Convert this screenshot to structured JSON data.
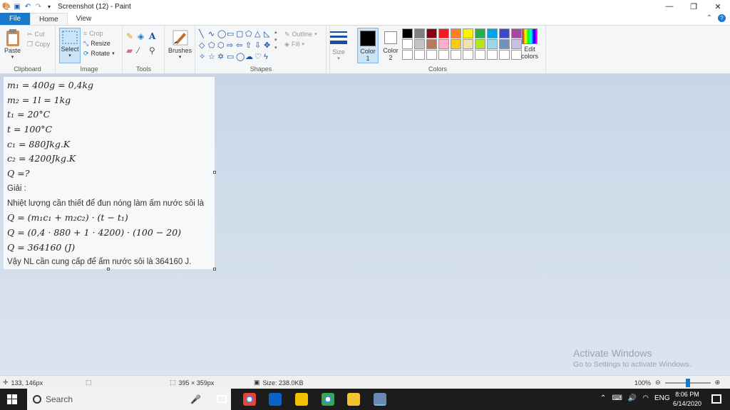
{
  "window": {
    "title": "Screenshot (12) - Paint",
    "minimize": "—",
    "maximize": "❐",
    "close": "✕"
  },
  "tabs": {
    "file": "File",
    "home": "Home",
    "view": "View"
  },
  "ribbon": {
    "clipboard": {
      "label": "Clipboard",
      "paste": "Paste",
      "cut": "Cut",
      "copy": "Copy"
    },
    "image": {
      "label": "Image",
      "select": "Select",
      "crop": "Crop",
      "resize": "Resize",
      "rotate": "Rotate"
    },
    "tools": {
      "label": "Tools"
    },
    "brushes": {
      "label": "Brushes"
    },
    "shapes": {
      "label": "Shapes",
      "outline": "Outline",
      "fill": "Fill"
    },
    "size": {
      "label": "Size"
    },
    "color1": {
      "label": "Color",
      "num": "1"
    },
    "color2": {
      "label": "Color",
      "num": "2"
    },
    "edit_colors": {
      "line1": "Edit",
      "line2": "colors"
    },
    "colors": {
      "label": "Colors"
    }
  },
  "palette": [
    "#000000",
    "#7f7f7f",
    "#880015",
    "#ed1c24",
    "#ff7f27",
    "#fff200",
    "#22b14c",
    "#00a2e8",
    "#3f48cc",
    "#a349a4",
    "#ffffff",
    "#c3c3c3",
    "#b97a57",
    "#ffaec9",
    "#ffc90e",
    "#efe4b0",
    "#b5e61d",
    "#99d9ea",
    "#7092be",
    "#c8bfe7",
    "#ffffff",
    "#ffffff",
    "#ffffff",
    "#ffffff",
    "#ffffff",
    "#ffffff",
    "#ffffff",
    "#ffffff",
    "#ffffff",
    "#ffffff"
  ],
  "image_lines": [
    {
      "text": "m₁ = 400g = 0,4kg",
      "kind": "math"
    },
    {
      "text": "m₂ = 1l = 1kg",
      "kind": "math"
    },
    {
      "text": "t₁ = 20°C",
      "kind": "math"
    },
    {
      "text": "t = 100°C",
      "kind": "math"
    },
    {
      "text": "c₁ = 880Jkg.K",
      "kind": "math"
    },
    {
      "text": "c₂ = 4200Jkg.K",
      "kind": "math"
    },
    {
      "text": "Q =?",
      "kind": "math"
    },
    {
      "text": "Giải :",
      "kind": "text"
    },
    {
      "text": "Nhiệt lượng cần thiết để đun nóng làm ấm nước sôi là",
      "kind": "text"
    },
    {
      "text": "Q = (m₁c₁ + m₂c₂) · (t − t₁)",
      "kind": "math"
    },
    {
      "text": "Q = (0,4 · 880 + 1 · 4200) · (100 − 20)",
      "kind": "math"
    },
    {
      "text": "Q = 364160 (J)",
      "kind": "math"
    },
    {
      "text": "Vậy NL cần cung cấp để ấm nước sôi là 364160 J.",
      "kind": "text"
    }
  ],
  "watermark": {
    "line1": "Activate Windows",
    "line2": "Go to Settings to activate Windows."
  },
  "status": {
    "cursor": "133, 146px",
    "selection": "395 × 359px",
    "size": "Size: 238.0KB",
    "zoom": "100%"
  },
  "taskbar": {
    "search": "Search",
    "lang": "ENG",
    "time": "8:06 PM",
    "date": "6/14/2020"
  }
}
